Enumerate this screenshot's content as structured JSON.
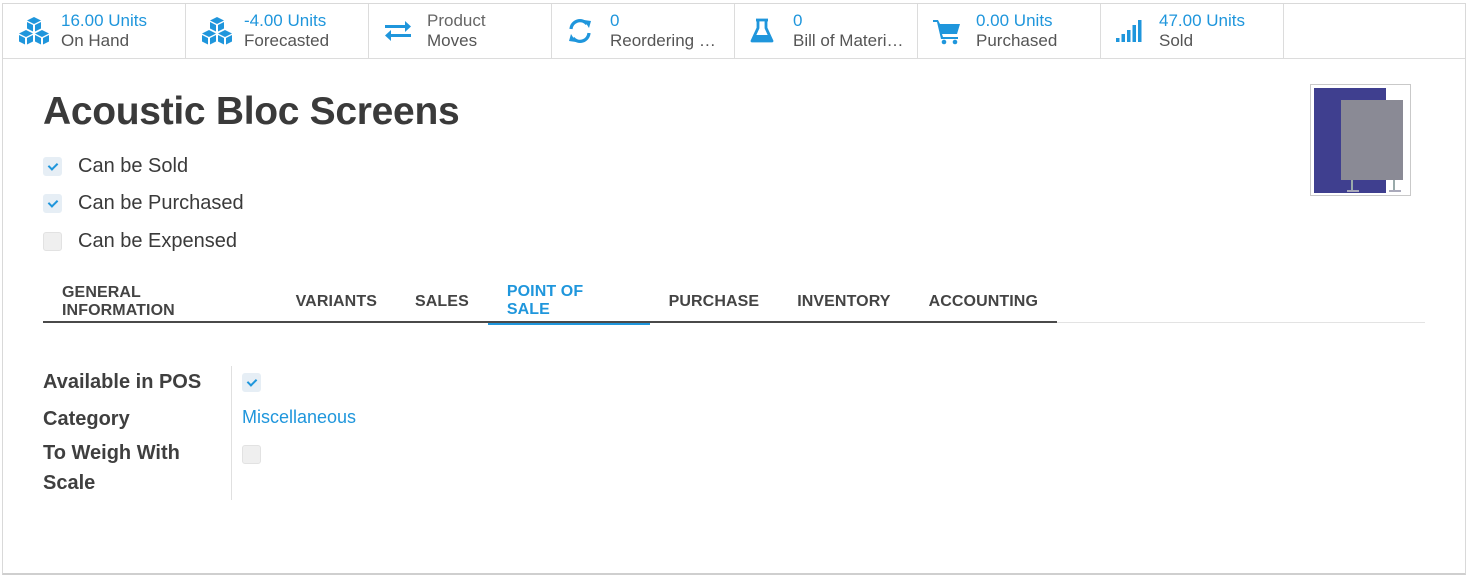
{
  "colors": {
    "accent": "#1f96dc",
    "text": "#3a3a3a"
  },
  "smart_buttons": [
    {
      "icon": "cubes-icon",
      "value": "16.00 Units",
      "label": "On Hand"
    },
    {
      "icon": "cubes-icon",
      "value": "-4.00 Units",
      "label": "Forecasted"
    },
    {
      "icon": "exchange-icon",
      "value": "Product",
      "label": "Moves"
    },
    {
      "icon": "refresh-icon",
      "value": "0",
      "label": "Reordering …"
    },
    {
      "icon": "flask-icon",
      "value": "0",
      "label": "Bill of Materi…"
    },
    {
      "icon": "shopping-cart-icon",
      "value": "0.00 Units",
      "label": "Purchased"
    },
    {
      "icon": "signal-icon",
      "value": "47.00 Units",
      "label": "Sold"
    }
  ],
  "product": {
    "name": "Acoustic Bloc Screens",
    "can_be_sold": {
      "label": "Can be Sold",
      "checked": true
    },
    "can_be_purchased": {
      "label": "Can be Purchased",
      "checked": true
    },
    "can_be_expensed": {
      "label": "Can be Expensed",
      "checked": false
    }
  },
  "tabs": [
    {
      "label": "GENERAL INFORMATION",
      "active": false
    },
    {
      "label": "VARIANTS",
      "active": false
    },
    {
      "label": "SALES",
      "active": false
    },
    {
      "label": "POINT OF SALE",
      "active": true
    },
    {
      "label": "PURCHASE",
      "active": false
    },
    {
      "label": "INVENTORY",
      "active": false
    },
    {
      "label": "ACCOUNTING",
      "active": false
    }
  ],
  "pos": {
    "available_in_pos": {
      "label": "Available in POS",
      "checked": true
    },
    "category": {
      "label": "Category",
      "value": "Miscellaneous"
    },
    "to_weigh": {
      "label_line1": "To Weigh With",
      "label_line2": "Scale",
      "checked": false
    }
  }
}
